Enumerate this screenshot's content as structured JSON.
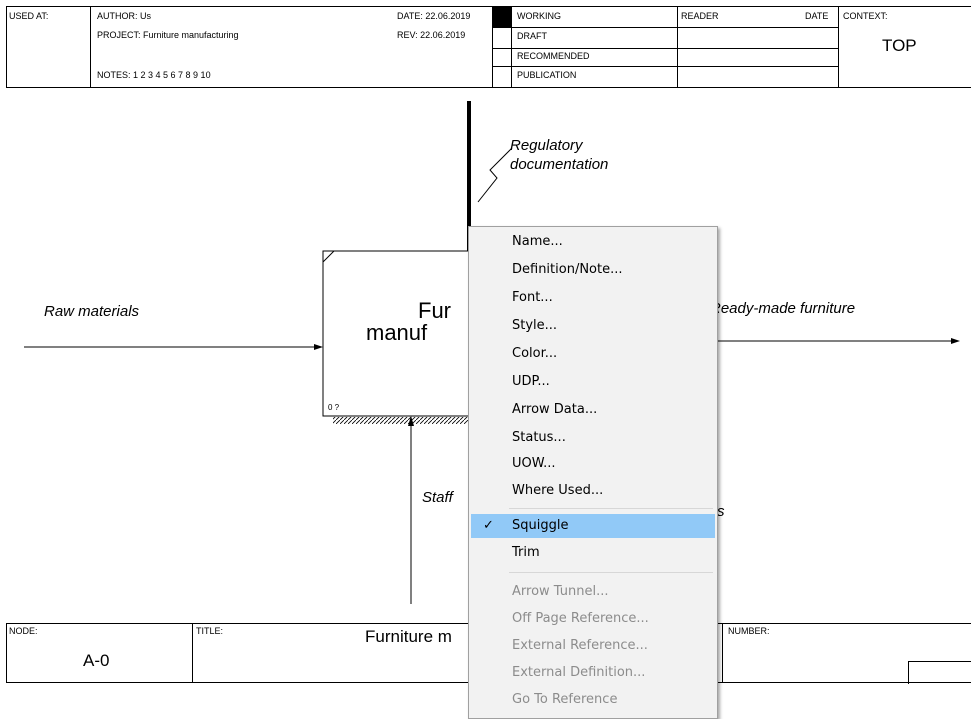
{
  "header": {
    "used_at": "USED AT:",
    "author": "AUTHOR:  Us",
    "project": "PROJECT:  Furniture manufacturing",
    "notes": "NOTES:  1  2  3  4  5  6  7  8  9  10",
    "date": "DATE:  22.06.2019",
    "rev": "REV:   22.06.2019",
    "status": [
      "WORKING",
      "DRAFT",
      "RECOMMENDED",
      "PUBLICATION"
    ],
    "reader": "READER",
    "reader_date": "DATE",
    "context": "CONTEXT:",
    "context_value": "TOP"
  },
  "diagram": {
    "box_title_line1": "Fur",
    "box_title_line2": "manuf",
    "box_corner": "0 ?",
    "arrows": {
      "control": "Regulatory\ndocumentation",
      "input": "Raw materials",
      "output": "Ready-made furniture",
      "mechanism": "Staff",
      "hidden_partial": "s"
    }
  },
  "footer": {
    "node_label": "NODE:",
    "node_value": "A-0",
    "title_label": "TITLE:",
    "title_value": "Furniture m",
    "number_label": "NUMBER:"
  },
  "context_menu": {
    "items": [
      {
        "label": "Name...",
        "enabled": true
      },
      {
        "label": "Definition/Note...",
        "enabled": true
      },
      {
        "label": "Font...",
        "enabled": true
      },
      {
        "label": "Style...",
        "enabled": true
      },
      {
        "label": "Color...",
        "enabled": true
      },
      {
        "label": "UDP...",
        "enabled": true
      },
      {
        "label": "Arrow Data...",
        "enabled": true
      },
      {
        "label": "Status...",
        "enabled": true
      },
      {
        "label": "UOW...",
        "enabled": true
      },
      {
        "label": "Where Used...",
        "enabled": true
      },
      {
        "label": "Squiggle",
        "enabled": true,
        "checked": true,
        "highlighted": true
      },
      {
        "label": "Trim",
        "enabled": true
      },
      {
        "label": "Arrow Tunnel...",
        "enabled": false
      },
      {
        "label": "Off Page Reference...",
        "enabled": false
      },
      {
        "label": "External Reference...",
        "enabled": false
      },
      {
        "label": "External Definition...",
        "enabled": false
      },
      {
        "label": "Go To Reference",
        "enabled": false
      }
    ],
    "check_icon": "checkmark-icon",
    "highlight_color": "#91c9f7"
  }
}
